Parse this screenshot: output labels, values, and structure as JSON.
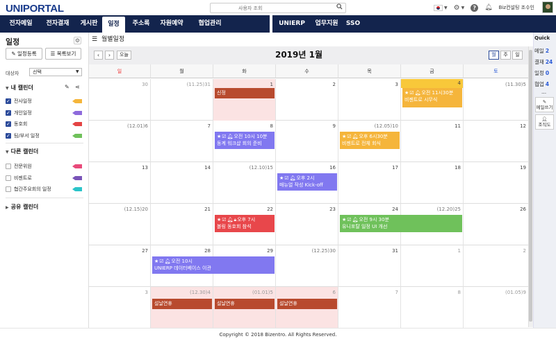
{
  "app": {
    "logo": "UNIPORTAL"
  },
  "header": {
    "search_placeholder": "사용자 조회",
    "user_name": "Biz컨설팅 조수인"
  },
  "nav": {
    "left": [
      "전자메일",
      "전자결재",
      "게시판",
      "일정",
      "주소록",
      "자원예약",
      "협업관리"
    ],
    "right": [
      "UNIERP",
      "업무지원",
      "SSO"
    ],
    "active": "일정"
  },
  "sidebar": {
    "title": "일정",
    "btn_register": "일정등록",
    "btn_list": "목록보기",
    "dept_label": "대상자",
    "dept_value": "선택",
    "my_calendar": "내 캘린더",
    "my_items": [
      {
        "label": "전사일정",
        "color": "#f5b53b"
      },
      {
        "label": "개인일정",
        "color": "#8e6bdc"
      },
      {
        "label": "동호회",
        "color": "#e44444"
      },
      {
        "label": "팀/부서 일정",
        "color": "#6fc15b"
      }
    ],
    "other_calendar": "다른 캘린더",
    "other_items": [
      {
        "label": "전문위원",
        "color": "#e84a7a"
      },
      {
        "label": "비젠트로",
        "color": "#7a54b8"
      },
      {
        "label": "협간주요회의 일정",
        "color": "#2bc4c9"
      }
    ],
    "shared_calendar": "공유 캘린더"
  },
  "main": {
    "header": "월별일정",
    "today": "오늘",
    "month_title": "2019년 1월",
    "views": [
      "월",
      "주",
      "일"
    ],
    "weekdays": [
      "일",
      "월",
      "화",
      "수",
      "목",
      "금",
      "토"
    ],
    "weeks": [
      [
        "30",
        "(11.25)31",
        "1",
        "2",
        "3",
        "4",
        "(11.30)5"
      ],
      [
        "(12.01)6",
        "7",
        "8",
        "9",
        "(12.05)10",
        "11",
        "12"
      ],
      [
        "13",
        "14",
        "(12.10)15",
        "16",
        "17",
        "18",
        "19"
      ],
      [
        "(12.15)20",
        "21",
        "22",
        "23",
        "24",
        "(12.20)25",
        "26"
      ],
      [
        "27",
        "28",
        "29",
        "(12.25)30",
        "31",
        "1",
        "2"
      ],
      [
        "3",
        "(12.30)4",
        "(01.01)5",
        "6",
        "7",
        "8",
        "(01.05)9"
      ]
    ],
    "events": {
      "e1": "신정",
      "e2_time": "오전 11시30분",
      "e2_title": "비젠트로 시무식",
      "e3_time": "오전 10시 10분",
      "e3_title": "동계 워크샵 회의 준비",
      "e4_time": "오후 6시30분",
      "e4_title": "비젠트로 전체 회식",
      "e5_time": "오후 2시",
      "e5_title": "매뉴얼 작성 Kick-off",
      "e6_time": "오후 7시",
      "e6_title": "볼링 동호회 참석",
      "e7_time": "오전 9시 30분",
      "e7_title": "유니포탈 일정 UI 개선",
      "e8_time": "오전 10시",
      "e8_title": "UNIERP 데이터베이스 이관",
      "e9": "설날연휴",
      "e10": "설날연휴",
      "e11": "설날연휴"
    },
    "colors": {
      "holiday": "#b84a2e",
      "company": "#f5b53b",
      "personal": "#8178f0",
      "club": "#e8474b",
      "team": "#6fc15b"
    }
  },
  "quick": {
    "title": "Quick",
    "items": [
      {
        "label": "메일",
        "count": "2"
      },
      {
        "label": "결재",
        "count": "24"
      },
      {
        "label": "일정",
        "count": "0"
      },
      {
        "label": "협업",
        "count": "4"
      }
    ],
    "more": "...",
    "btn_mail": "메일쓰기",
    "btn_org": "조직도"
  },
  "footer": "Copyright © 2018 Bizentro. All Rights Reserved."
}
